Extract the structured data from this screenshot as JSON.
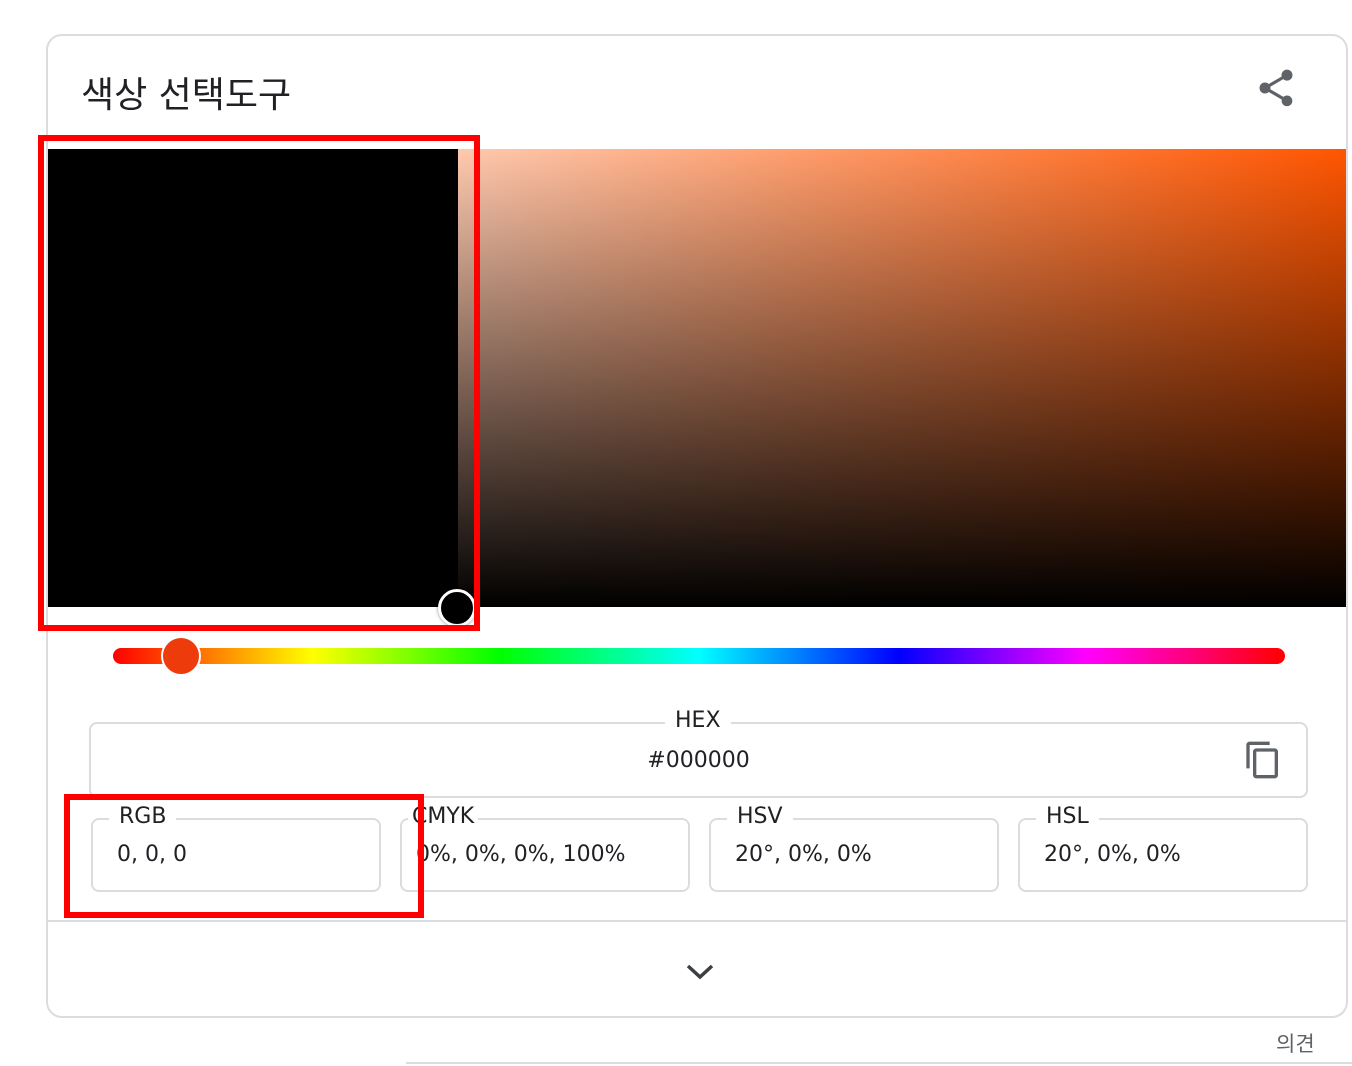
{
  "title": "색상 선택도구",
  "icons": {
    "share": "share-icon",
    "copy": "copy-icon",
    "expand": "chevron-down-icon"
  },
  "picker": {
    "selected_color": "#000000",
    "hue_color": "#ee3b0b",
    "hue_position": 0.06
  },
  "fields": {
    "hex": {
      "label": "HEX",
      "value": "#000000"
    },
    "rgb": {
      "label": "RGB",
      "value": "0, 0, 0"
    },
    "cmyk": {
      "label": "CMYK",
      "value": "0%, 0%, 0%, 100%"
    },
    "hsv": {
      "label": "HSV",
      "value": "20°, 0%, 0%"
    },
    "hsl": {
      "label": "HSL",
      "value": "20°, 0%, 0%"
    }
  },
  "feedback": "의견",
  "annotation_color": "#ff0000"
}
